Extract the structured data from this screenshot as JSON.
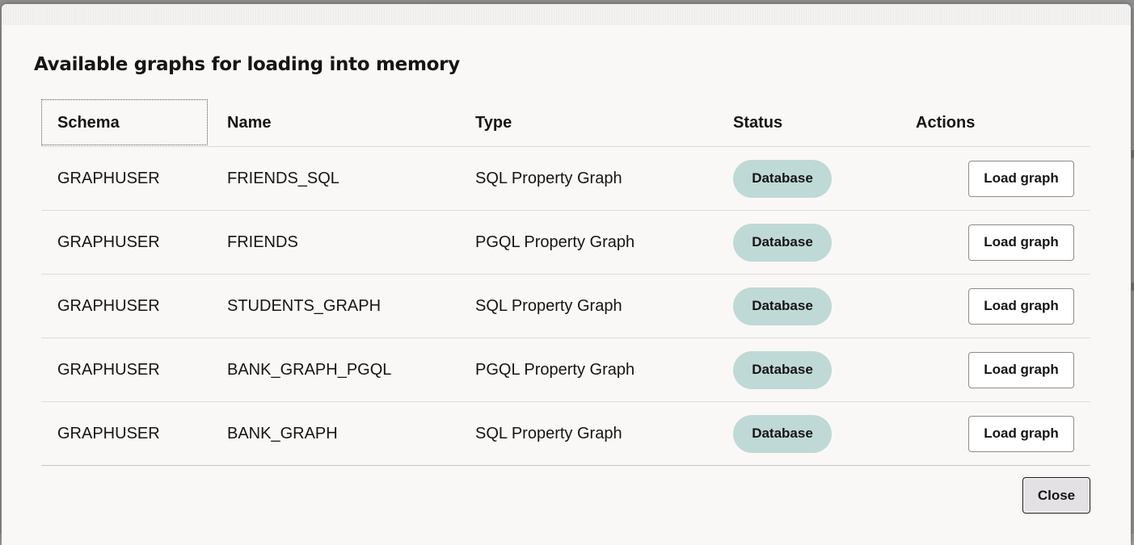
{
  "dialog": {
    "title": "Available graphs for loading into memory",
    "close_label": "Close"
  },
  "table": {
    "headers": {
      "schema": "Schema",
      "name": "Name",
      "type": "Type",
      "status": "Status",
      "actions": "Actions"
    },
    "rows": [
      {
        "schema": "GRAPHUSER",
        "name": "FRIENDS_SQL",
        "type": "SQL Property Graph",
        "status": "Database",
        "action": "Load graph"
      },
      {
        "schema": "GRAPHUSER",
        "name": "FRIENDS",
        "type": "PGQL Property Graph",
        "status": "Database",
        "action": "Load graph"
      },
      {
        "schema": "GRAPHUSER",
        "name": "STUDENTS_GRAPH",
        "type": "SQL Property Graph",
        "status": "Database",
        "action": "Load graph"
      },
      {
        "schema": "GRAPHUSER",
        "name": "BANK_GRAPH_PGQL",
        "type": "PGQL Property Graph",
        "status": "Database",
        "action": "Load graph"
      },
      {
        "schema": "GRAPHUSER",
        "name": "BANK_GRAPH",
        "type": "SQL Property Graph",
        "status": "Database",
        "action": "Load graph"
      }
    ]
  },
  "colors": {
    "status_badge_bg": "#bfd9d6",
    "dialog_bg": "#f9f8f6",
    "text": "#161513"
  }
}
